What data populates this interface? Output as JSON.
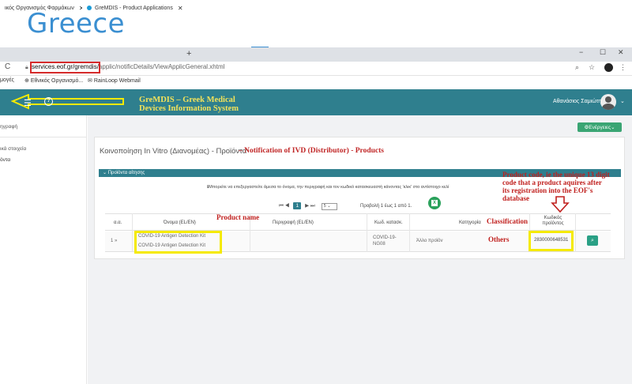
{
  "slide": {
    "title": "Greece"
  },
  "browser": {
    "tabs": [
      {
        "label": "ικός Οργανισμός Φαρμάκων"
      },
      {
        "label": "GreMDIS - Product Applications"
      }
    ],
    "new_tab": "+",
    "window_controls": [
      "−",
      "☐",
      "✕"
    ],
    "url_host": "services.eof.gr/gremdis/",
    "url_rest": "applic/notificDetails/ViewApplicGeneral.xhtml",
    "bookmarks": [
      "μογές",
      "Εθνικός Οργανισμό...",
      "RainLoop Webmail"
    ]
  },
  "app": {
    "title_line1": "GreMDIS – Greek Medical",
    "title_line2": "Devices Information System",
    "help": "?",
    "user_name": "Αθανάσιος Σαμιώτης",
    "actions_label": "Ενέργειες"
  },
  "sidebar": {
    "items": [
      "ηγραφή",
      "ικά στοιχεία",
      "όντα"
    ]
  },
  "page": {
    "heading_gr": "Κοινοποίηση In Vitro (Διανομέας) - Προϊόντα",
    "heading_en": "– Notification of IVD (Distributor) - Products",
    "panel_title": "Προϊόντα αίτησης",
    "info_text": "Μπορείτε να επεξεργαστείτε άμεσα το όνομα, την περιγραφή και τον κωδικό κατασκευαστή κάνοντας 'κλικ' στο αντίστοιχο κελί",
    "pager": {
      "current_page": "1",
      "page_size": "5",
      "info": "Προβολή 1 έως 1 από 1."
    },
    "columns": [
      "α.α.",
      "Όνομα (EL/EN)",
      "Περιγραφή (EL/EN)",
      "Κωδ. κατασκ.",
      "Κατηγορία",
      "Κωδικός προϊόντος"
    ],
    "rows": [
      {
        "index": "1 »",
        "name_el": "COVID-19 Antigen Detection Kit",
        "name_en": "COVID-19 Antigen Detection Kit",
        "description": "",
        "mfr_code_1": "COVID-19-",
        "mfr_code_2": "NG08",
        "category": "Άλλο προϊόν",
        "product_code": "2830000648531"
      }
    ]
  },
  "annotations": {
    "product_name": "Product name",
    "classification": "Classification",
    "others": "Others",
    "product_code_note_1": "Product code, ie the unique 13 digit",
    "product_code_note_2": "code that a product aquires after",
    "product_code_note_3": "its registration into the EOF's",
    "product_code_note_4": "database"
  },
  "colors": {
    "title_blue": "#3b8fd1",
    "header_teal": "#2f7f8e",
    "annotation_red": "#c0201e",
    "highlight_yellow": "#f5ea00",
    "app_title_yellow": "#f2e25a",
    "actions_green": "#3aa573"
  }
}
